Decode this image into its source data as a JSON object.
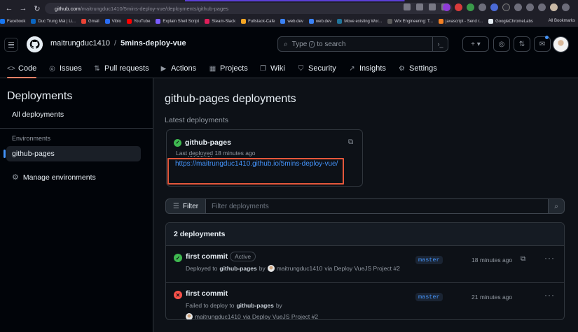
{
  "browser": {
    "url_host": "github.com",
    "url_path": "/maitrungduc1410/5mins-deploy-vue/deployments/github-pages",
    "bookmarks": [
      "Facebook",
      "Duc Trung Mai | Li...",
      "Gmail",
      "Viblo",
      "YouTube",
      "Explain Shell Script",
      "Steam-Slack",
      "Fullstack-Cafe",
      "web.dev",
      "web.dev",
      "Move existing Wor...",
      "Wix Engineering: T...",
      "javascript - Send r...",
      "GoogleChromeLabs"
    ],
    "all_bookmarks": "All Bookmarks"
  },
  "header": {
    "owner": "maitrungduc1410",
    "separator": "/",
    "repo": "5mins-deploy-vue",
    "search_prefix": "Type",
    "search_key": "/",
    "search_suffix": "to search"
  },
  "tabs": [
    {
      "label": "Code",
      "icon": "<>"
    },
    {
      "label": "Issues",
      "icon": "◎"
    },
    {
      "label": "Pull requests",
      "icon": "⇅"
    },
    {
      "label": "Actions",
      "icon": "▶"
    },
    {
      "label": "Projects",
      "icon": "▦"
    },
    {
      "label": "Wiki",
      "icon": "❐"
    },
    {
      "label": "Security",
      "icon": "⛉"
    },
    {
      "label": "Insights",
      "icon": "↗"
    },
    {
      "label": "Settings",
      "icon": "⚙"
    }
  ],
  "sidebar": {
    "title": "Deployments",
    "all": "All deployments",
    "env_label": "Environments",
    "env_item": "github-pages",
    "manage": "Manage environments"
  },
  "main": {
    "title": "github-pages deployments",
    "latest_label": "Latest deployments",
    "card": {
      "name": "github-pages",
      "meta_prefix": "Last",
      "meta_deployed": "deployed",
      "meta_time": "18 minutes ago",
      "url": "https://maitrungduc1410.github.io/5mins-deploy-vue/"
    },
    "filter_label": "Filter",
    "filter_placeholder": "Filter deployments",
    "list_title": "2 deployments",
    "rows": [
      {
        "commit": "first commit",
        "badge": "Active",
        "desc_a": "Deployed to",
        "env": "github-pages",
        "by": "by",
        "user": "maitrungduc1410",
        "via": "via Deploy VueJS Project #2",
        "branch": "master",
        "time": "18 minutes ago",
        "status": "success"
      },
      {
        "commit": "first commit",
        "desc_a": "Failed to deploy to",
        "env": "github-pages",
        "by": "by",
        "user": "maitrungduc1410",
        "via": "via Deploy VueJS Project #2",
        "branch": "master",
        "time": "21 minutes ago",
        "status": "failure"
      }
    ]
  },
  "colors": {
    "accent": "#4493f8",
    "success": "#3fb950",
    "failure": "#f85149",
    "highlight": "#e5573b",
    "tab_underline": "#f78166"
  }
}
